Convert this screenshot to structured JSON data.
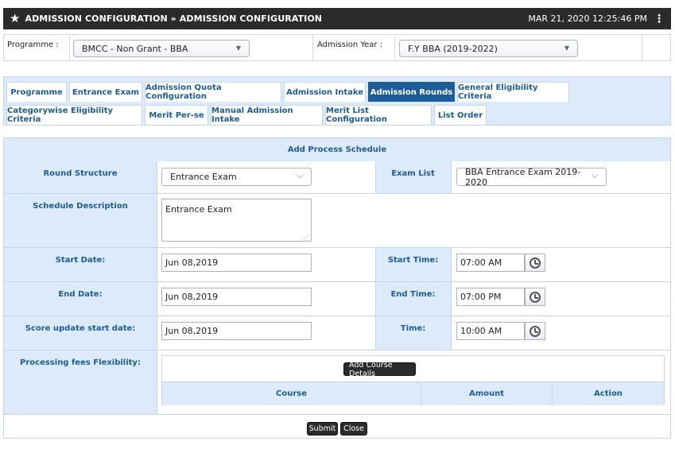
{
  "header": {
    "title": "ADMISSION CONFIGURATION » ADMISSION CONFIGURATION",
    "datetime": "MAR 21, 2020  12:25:46 PM"
  },
  "filters": {
    "programme_label": "Programme :",
    "programme_value": "BMCC - Non Grant - BBA",
    "year_label": "Admission Year :",
    "year_value": "F.Y BBA (2019-2022)"
  },
  "tabs": [
    {
      "label": "Programme"
    },
    {
      "label": "Entrance Exam"
    },
    {
      "label": "Admission Quota Configuration"
    },
    {
      "label": "Admission Intake"
    },
    {
      "label": "Admission Rounds"
    },
    {
      "label": "General Eligibility Criteria"
    },
    {
      "label": "Categorywise Eligibility Criteria"
    },
    {
      "label": "Merit Per-se"
    },
    {
      "label": "Manual Admission Intake"
    },
    {
      "label": "Merit List Configuration"
    },
    {
      "label": "List Order"
    }
  ],
  "active_tab": "Admission Rounds",
  "form": {
    "title": "Add Process Schedule",
    "round_structure_label": "Round Structure",
    "round_structure_value": "Entrance Exam",
    "exam_list_label": "Exam List",
    "exam_list_value": "BBA Entrance Exam 2019-2020",
    "schedule_description_label": "Schedule Description",
    "schedule_description_value": "Entrance Exam",
    "start_date_label": "Start Date:",
    "start_date_value": "Jun 08,2019",
    "start_time_label": "Start Time:",
    "start_time_value": "07:00 AM",
    "end_date_label": "End Date:",
    "end_date_value": "Jun 08,2019",
    "end_time_label": "End Time:",
    "end_time_value": "07:00 PM",
    "score_update_label": "Score update start date:",
    "score_update_value": "Jun 08,2019",
    "time_label": "Time:",
    "time_value": "10:00 AM",
    "processing_fees_label": "Processing fees Flexibility:",
    "add_course_button": "Add Course Details",
    "course_columns": [
      "Course",
      "Amount",
      "Action"
    ],
    "submit_button": "Submit",
    "close_button": "Close"
  }
}
